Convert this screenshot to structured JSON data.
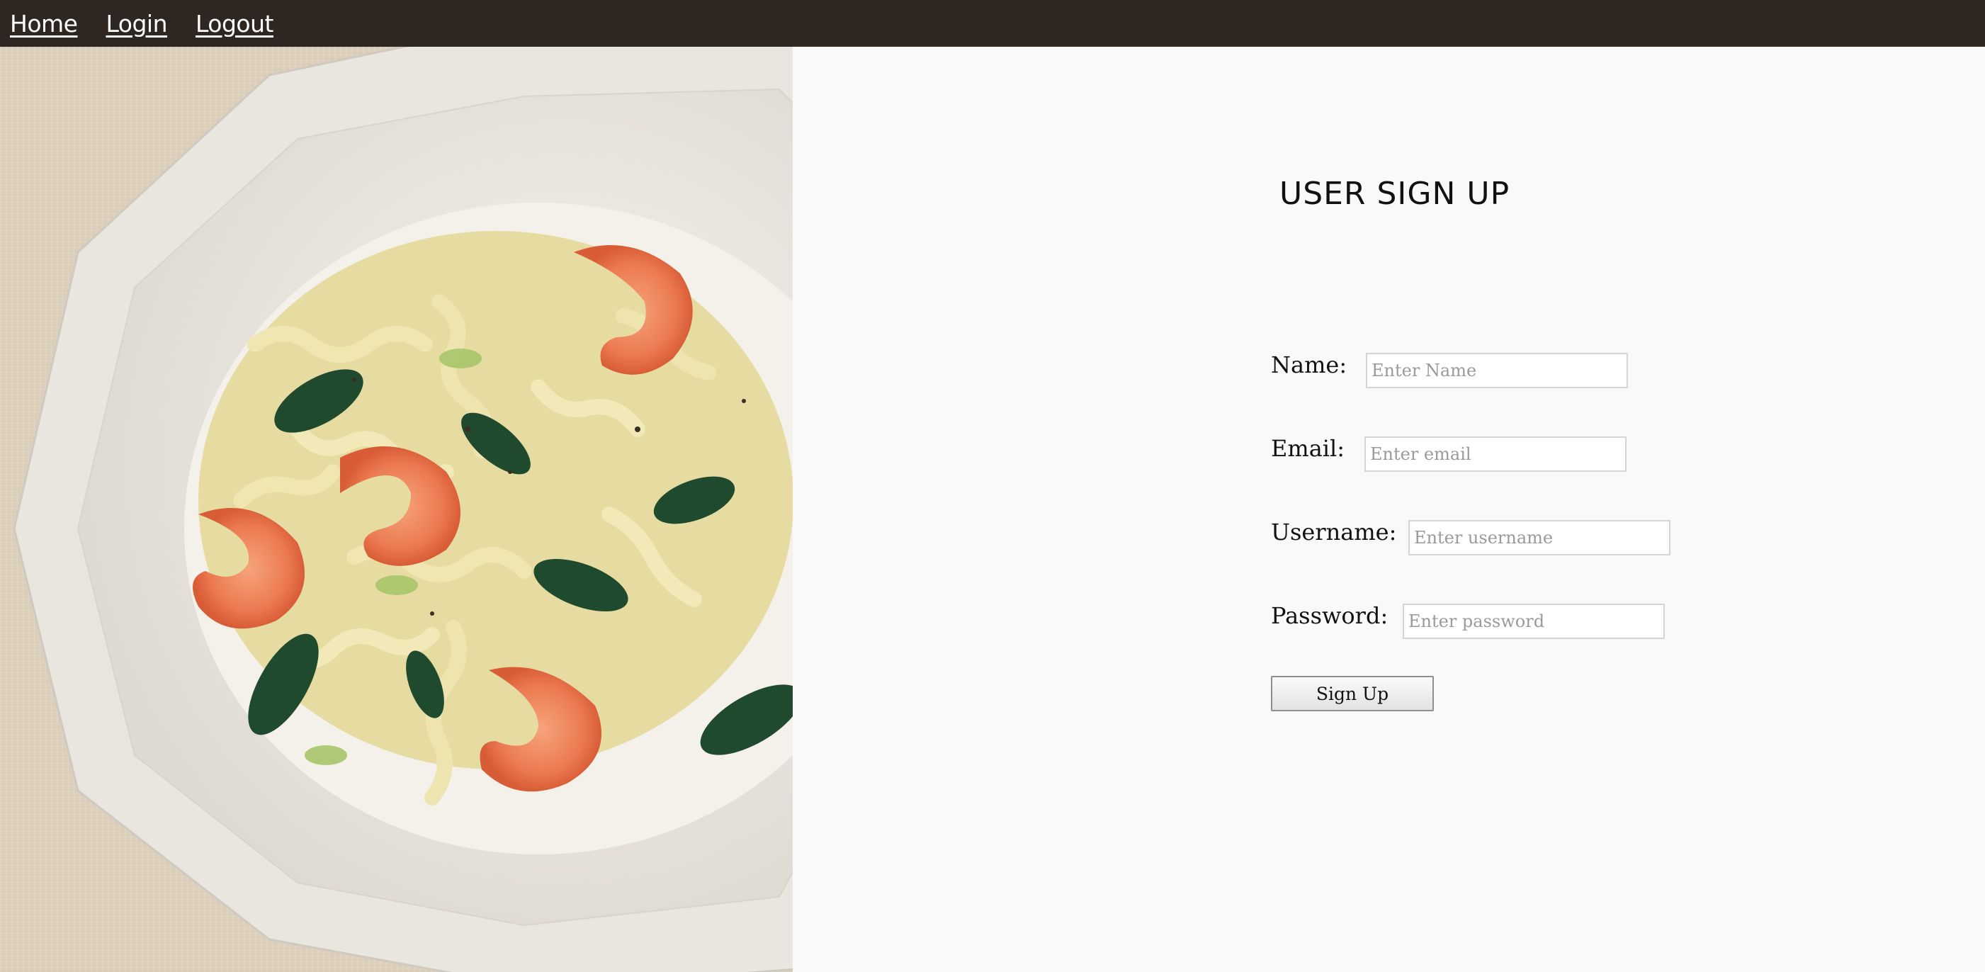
{
  "nav": {
    "home": "Home",
    "login": "Login",
    "logout": "Logout"
  },
  "hero_image": {
    "alt": "Plate of gemelli pasta with shrimp and spinach"
  },
  "form": {
    "title": "USER SIGN UP",
    "name_label": "Name:",
    "name_placeholder": "Enter Name",
    "email_label": "Email:",
    "email_placeholder": "Enter email",
    "username_label": "Username:",
    "username_placeholder": "Enter username",
    "password_label": "Password:",
    "password_placeholder": "Enter password",
    "submit_label": "Sign Up"
  },
  "colors": {
    "navbar": "#2e2620",
    "panel_background": "#f9f9f9"
  }
}
